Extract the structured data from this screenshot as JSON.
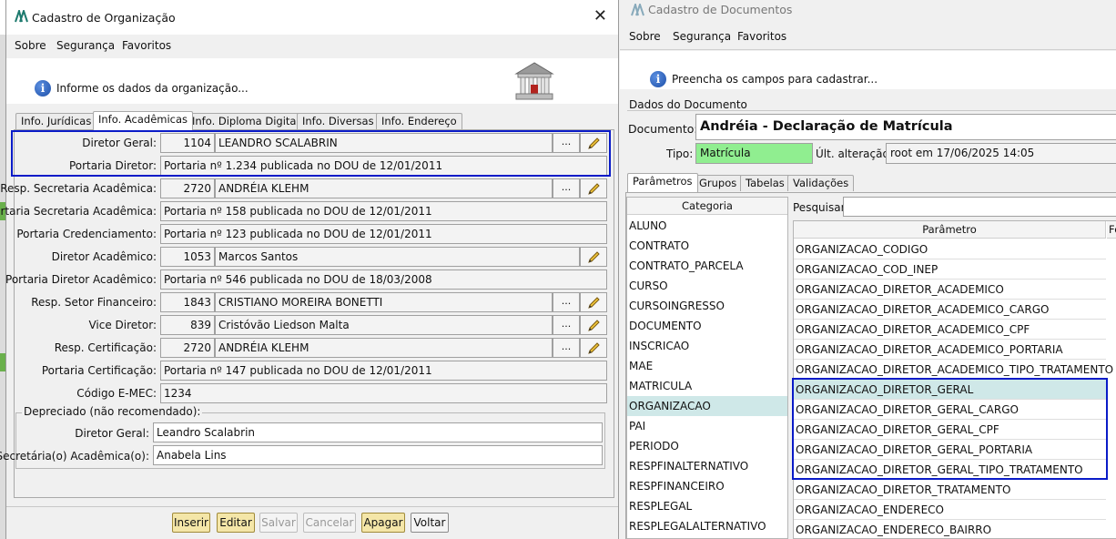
{
  "left": {
    "title": "Cadastro de Organização",
    "menu": [
      "Sobre",
      "Segurança",
      "Favoritos"
    ],
    "info_text": "Informe os dados da organização...",
    "tabs": [
      "Info. Jurídicas",
      "Info. Acadêmicas",
      "Info. Diploma Digital",
      "Info. Diversas",
      "Info. Endereço"
    ],
    "active_tab": "Info. Acadêmicas",
    "fields": {
      "diretor_geral": {
        "label": "Diretor Geral:",
        "code": "1104",
        "name": "LEANDRO SCALABRIN"
      },
      "portaria_diretor": {
        "label": "Portaria Diretor:",
        "value": "Portaria nº 1.234 publicada no DOU de 12/01/2011"
      },
      "resp_secretaria": {
        "label": "Resp. Secretaria Acadêmica:",
        "code": "2720",
        "name": "ANDRÉIA KLEHM"
      },
      "portaria_secretaria": {
        "label": "Portaria Secretaria Acadêmica:",
        "value": "Portaria nº 158 publicada no DOU de 12/01/2011"
      },
      "portaria_credenciamento": {
        "label": "Portaria Credenciamento:",
        "value": "Portaria nº 123 publicada no DOU de 12/01/2011"
      },
      "diretor_academico": {
        "label": "Diretor Acadêmico:",
        "code": "1053",
        "name": "Marcos Santos"
      },
      "portaria_diretor_academico": {
        "label": "Portaria Diretor Acadêmico:",
        "value": "Portaria nº 546 publicada no DOU de 18/03/2008"
      },
      "resp_setor_financeiro": {
        "label": "Resp. Setor Financeiro:",
        "code": "1843",
        "name": "CRISTIANO MOREIRA BONETTI"
      },
      "vice_diretor": {
        "label": "Vice Diretor:",
        "code": "839",
        "name": "Cristóvão Liedson Malta"
      },
      "resp_certificacao": {
        "label": "Resp. Certificação:",
        "code": "2720",
        "name": "ANDRÉIA KLEHM"
      },
      "portaria_certificacao": {
        "label": "Portaria Certificação:",
        "value": "Portaria nº 147 publicada no DOU de 12/01/2011"
      },
      "codigo_emec": {
        "label": "Código E-MEC:",
        "value": "1234"
      }
    },
    "deprecated": {
      "title": "Depreciado (não recomendado):",
      "diretor_geral": {
        "label": "Diretor Geral:",
        "value": "Leandro Scalabrin"
      },
      "secretaria": {
        "label": "Secretária(o) Acadêmica(o):",
        "value": "Anabela Lins"
      }
    },
    "dots_label": "...",
    "buttons": {
      "inserir": "Inserir",
      "editar": "Editar",
      "salvar": "Salvar",
      "cancelar": "Cancelar",
      "apagar": "Apagar",
      "voltar": "Voltar"
    }
  },
  "right": {
    "title": "Cadastro de Documentos",
    "menu": [
      "Sobre",
      "Segurança",
      "Favoritos"
    ],
    "info_text": "Preencha os campos para cadastrar...",
    "section_title": "Dados do Documento",
    "documento_label": "Documento:",
    "documento_value": "Andréia - Declaração de Matrícula",
    "tipo_label": "Tipo:",
    "tipo_value": "Matrícula",
    "tipo_color": "#90ee90",
    "ult_alteracao_label": "Últ. alteração:",
    "ult_alteracao_value": "root em 17/06/2025 14:05",
    "tabs": [
      "Parâmetros",
      "Grupos",
      "Tabelas",
      "Validações"
    ],
    "active_tab": "Parâmetros",
    "categoria_header": "Categoria",
    "categorias": [
      "ALUNO",
      "CONTRATO",
      "CONTRATO_PARCELA",
      "CURSO",
      "CURSOINGRESSO",
      "DOCUMENTO",
      "INSCRICAO",
      "MAE",
      "MATRICULA",
      "ORGANIZACAO",
      "PAI",
      "PERIODO",
      "RESPFINALTERNATIVO",
      "RESPFINANCEIRO",
      "RESPLEGAL",
      "RESPLEGALALTERNATIVO"
    ],
    "selected_categoria": "ORGANIZACAO",
    "pesquisar_label": "Pesquisar:",
    "pesquisar_value": "",
    "parametro_header": "Parâmetro",
    "second_header": "Fo",
    "parametros": [
      "ORGANIZACAO_CODIGO",
      "ORGANIZACAO_COD_INEP",
      "ORGANIZACAO_DIRETOR_ACADEMICO",
      "ORGANIZACAO_DIRETOR_ACADEMICO_CARGO",
      "ORGANIZACAO_DIRETOR_ACADEMICO_CPF",
      "ORGANIZACAO_DIRETOR_ACADEMICO_PORTARIA",
      "ORGANIZACAO_DIRETOR_ACADEMICO_TIPO_TRATAMENTO",
      "ORGANIZACAO_DIRETOR_GERAL",
      "ORGANIZACAO_DIRETOR_GERAL_CARGO",
      "ORGANIZACAO_DIRETOR_GERAL_CPF",
      "ORGANIZACAO_DIRETOR_GERAL_PORTARIA",
      "ORGANIZACAO_DIRETOR_GERAL_TIPO_TRATAMENTO",
      "ORGANIZACAO_DIRETOR_TRATAMENTO",
      "ORGANIZACAO_ENDERECO",
      "ORGANIZACAO_ENDERECO_BAIRRO"
    ]
  }
}
